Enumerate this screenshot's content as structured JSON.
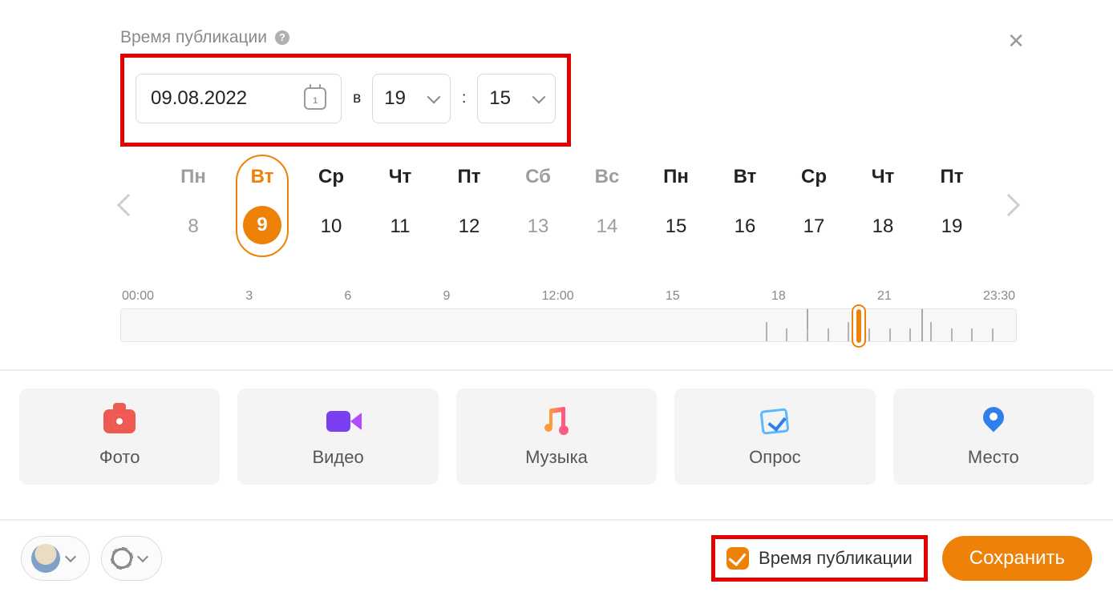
{
  "section": {
    "label": "Время публикации"
  },
  "date_field": {
    "value": "09.08.2022",
    "cal_day": "1"
  },
  "time": {
    "sep_word": "в",
    "hour": "19",
    "colon": ":",
    "minute": "15"
  },
  "days": [
    {
      "name": "Пн",
      "num": "8",
      "mode": "dim"
    },
    {
      "name": "Вт",
      "num": "9",
      "mode": "pill"
    },
    {
      "name": "Ср",
      "num": "10",
      "mode": ""
    },
    {
      "name": "Чт",
      "num": "11",
      "mode": ""
    },
    {
      "name": "Пт",
      "num": "12",
      "mode": ""
    },
    {
      "name": "Сб",
      "num": "13",
      "mode": "dim"
    },
    {
      "name": "Вс",
      "num": "14",
      "mode": "dim"
    },
    {
      "name": "Пн",
      "num": "15",
      "mode": ""
    },
    {
      "name": "Вт",
      "num": "16",
      "mode": ""
    },
    {
      "name": "Ср",
      "num": "17",
      "mode": ""
    },
    {
      "name": "Чт",
      "num": "18",
      "mode": ""
    },
    {
      "name": "Пт",
      "num": "19",
      "mode": ""
    }
  ],
  "timeline": {
    "labels": [
      "00:00",
      "3",
      "6",
      "9",
      "12:00",
      "15",
      "18",
      "21",
      "23:30"
    ]
  },
  "attachments": [
    {
      "key": "photo",
      "label": "Фото"
    },
    {
      "key": "video",
      "label": "Видео"
    },
    {
      "key": "music",
      "label": "Музыка"
    },
    {
      "key": "poll",
      "label": "Опрос"
    },
    {
      "key": "place",
      "label": "Место"
    }
  ],
  "footer": {
    "checkbox_label": "Время публикации",
    "save_label": "Сохранить"
  }
}
